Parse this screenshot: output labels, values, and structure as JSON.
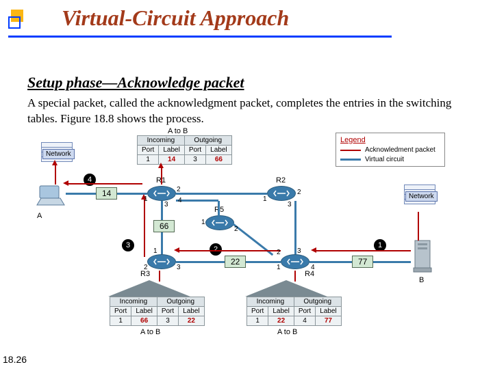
{
  "title": "Virtual-Circuit Approach",
  "subtitle": "Setup phase—Acknowledge packet",
  "body": "A special packet, called the acknowledgment packet, completes the entries in the switching tables. Figure 18.8 shows the process.",
  "page_number": "18.26",
  "diagram": {
    "top_table_caption": "A to B",
    "legend": {
      "title": "Legend",
      "row1": "Acknowledment packet",
      "row2": "Virtual circuit"
    },
    "net_label_A": "Network",
    "net_label_B": "Network",
    "host_A": "A",
    "host_B": "B",
    "routers": {
      "R1": "R1",
      "R2": "R2",
      "R3": "R3",
      "R4": "R4",
      "R5": "R5"
    },
    "steps": {
      "s1": "1",
      "s2": "2",
      "s3": "3",
      "s4": "4"
    },
    "labels": {
      "l14": "14",
      "l66": "66",
      "l22": "22",
      "l77": "77"
    },
    "ports": {
      "r1_1": "1",
      "r1_2": "2",
      "r1_3": "3",
      "r1_4": "4",
      "r2_1": "1",
      "r2_2": "2",
      "r2_3": "3",
      "r3_1": "1",
      "r3_2": "2",
      "r3_3": "3",
      "r4_1": "1",
      "r4_2": "2",
      "r4_3": "3",
      "r4_4": "4",
      "r5_1": "1",
      "r5_2": "2"
    },
    "top_table": {
      "incoming_hdr": "Incoming",
      "outgoing_hdr": "Outgoing",
      "port_hdr": "Port",
      "label_hdr": "Label",
      "in_port": "1",
      "in_label": "14",
      "out_port": "3",
      "out_label": "66"
    },
    "bottom_left_table": {
      "caption": "A to B",
      "incoming_hdr": "Incoming",
      "outgoing_hdr": "Outgoing",
      "port_hdr": "Port",
      "label_hdr": "Label",
      "in_port": "1",
      "in_label": "66",
      "out_port": "3",
      "out_label": "22"
    },
    "bottom_right_table": {
      "caption": "A to B",
      "incoming_hdr": "Incoming",
      "outgoing_hdr": "Outgoing",
      "port_hdr": "Port",
      "label_hdr": "Label",
      "in_port": "1",
      "in_label": "22",
      "out_port": "4",
      "out_label": "77"
    }
  }
}
